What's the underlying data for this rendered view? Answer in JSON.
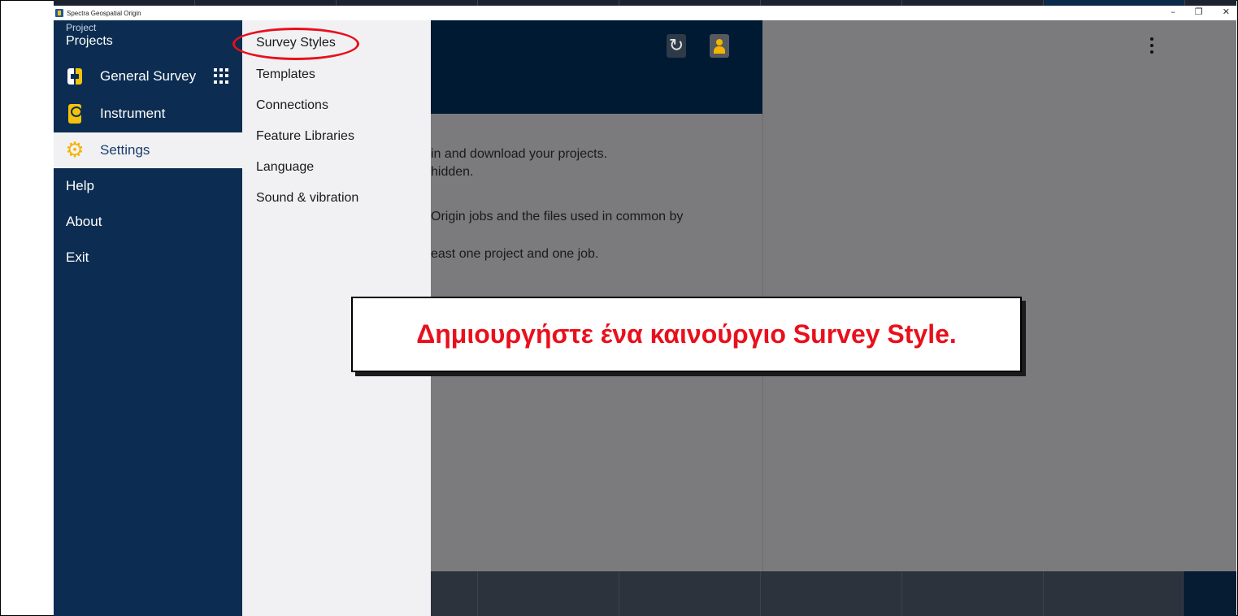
{
  "window": {
    "app_title": "Spectra Geospatial Origin",
    "controls": {
      "minimize": "–",
      "restore": "❐",
      "close": "✕"
    }
  },
  "sidebar": {
    "project_caption": "Project",
    "project_name": "Projects",
    "items": [
      {
        "label": "General Survey",
        "icon": "general-survey-icon"
      },
      {
        "label": "Instrument",
        "icon": "instrument-icon"
      },
      {
        "label": "Settings",
        "icon": "gear-icon",
        "active": true
      },
      {
        "label": "Help"
      },
      {
        "label": "About"
      },
      {
        "label": "Exit"
      }
    ],
    "apps_icon": "grid-icon"
  },
  "submenu": {
    "items": [
      "Survey Styles",
      "Templates",
      "Connections",
      "Feature Libraries",
      "Language",
      "Sound & vibration"
    ],
    "highlighted": "Survey Styles"
  },
  "header": {
    "refresh_glyph": "↻",
    "more_icon": "kebab-menu-icon"
  },
  "info": {
    "line1": "in and download your projects.",
    "line2": "hidden.",
    "line3": "Origin jobs and the files used in common by",
    "line4": "east one project and one job."
  },
  "annotation": {
    "text": "Δημιουργήστε ένα καινούργιο Survey Style.",
    "color": "#e8101c"
  },
  "colors": {
    "sidebar_bg": "#0c2d51",
    "submenu_bg": "#f1f1f4",
    "header_bg": "#001a33",
    "content_bg": "#7b7b7d",
    "accent_yellow": "#f4b400"
  }
}
